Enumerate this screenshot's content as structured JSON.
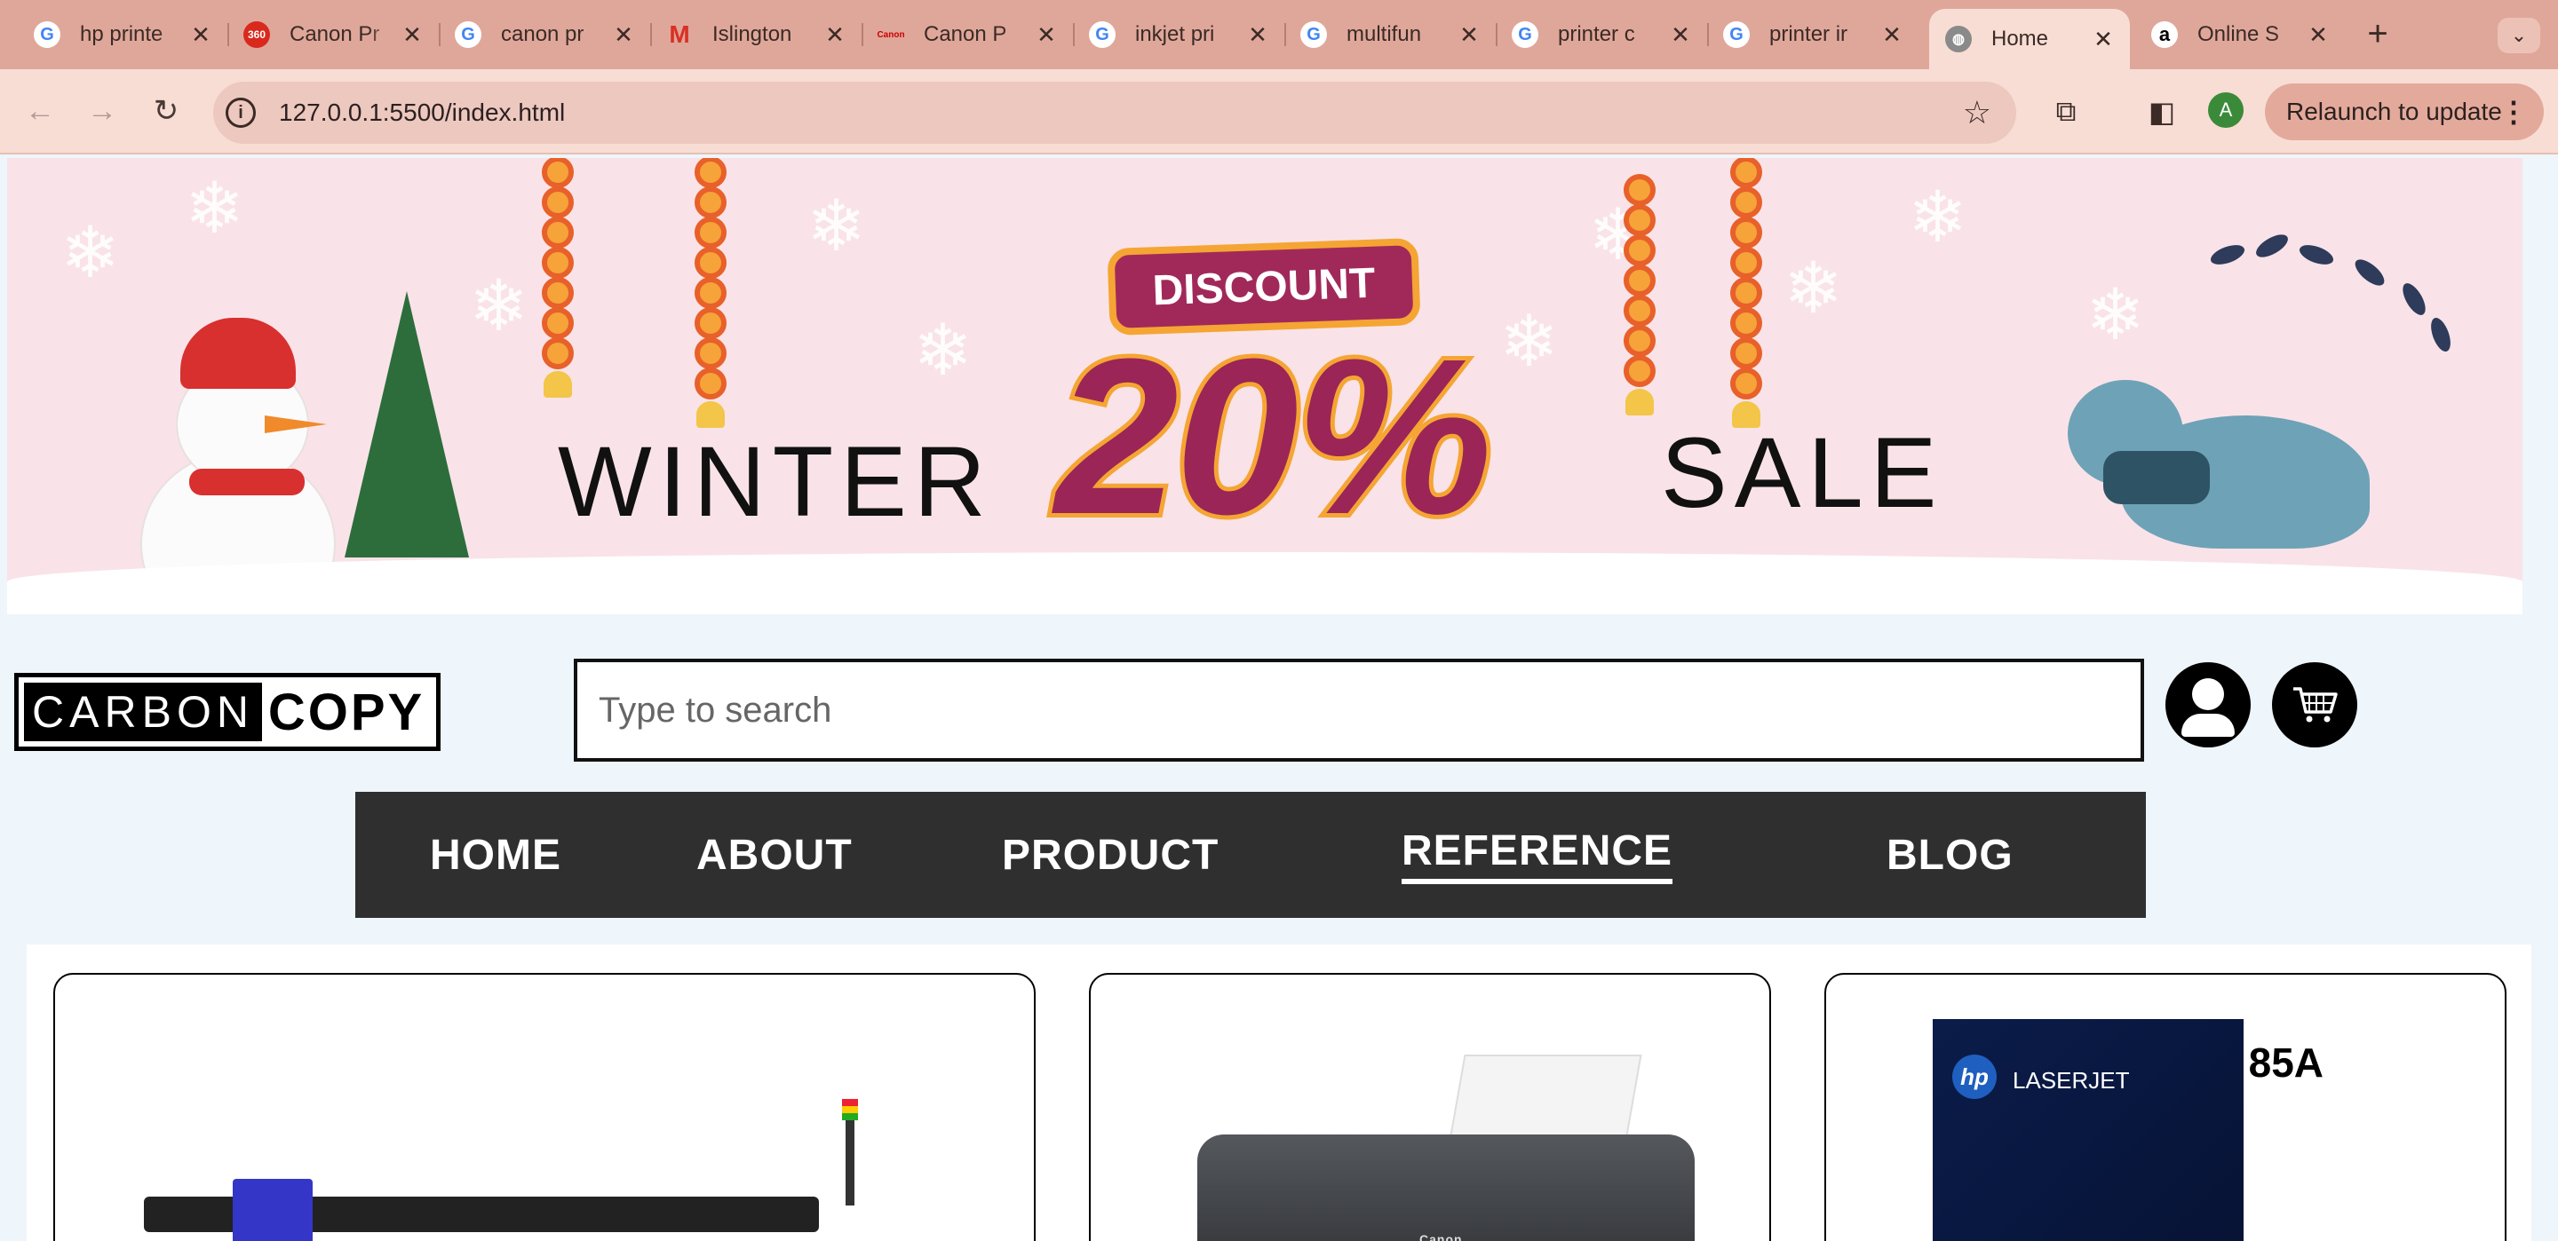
{
  "browser": {
    "tabs": [
      {
        "title": "hp printe",
        "favicon": "google-icon"
      },
      {
        "title": "Canon Pr",
        "favicon": "canon-360-icon"
      },
      {
        "title": "canon pr",
        "favicon": "google-icon"
      },
      {
        "title": "Islington",
        "favicon": "gmail-icon"
      },
      {
        "title": "Canon P",
        "favicon": "canon-icon"
      },
      {
        "title": "inkjet pri",
        "favicon": "google-icon"
      },
      {
        "title": "multifun",
        "favicon": "google-icon"
      },
      {
        "title": "printer c",
        "favicon": "google-icon"
      },
      {
        "title": "printer ir",
        "favicon": "google-icon"
      },
      {
        "title": "Home",
        "favicon": "globe-icon",
        "active": true
      },
      {
        "title": "Online S",
        "favicon": "amazon-icon"
      }
    ],
    "url": "127.0.0.1:5500/index.html",
    "profile_initial": "A",
    "relaunch_label": "Relaunch to update"
  },
  "banner": {
    "left_word": "WINTER",
    "badge": "DISCOUNT",
    "percent": "20%",
    "right_word": "SALE"
  },
  "header": {
    "logo_left": "CARBON",
    "logo_right": "COPY",
    "search_placeholder": "Type to search"
  },
  "nav": {
    "items": [
      "HOME",
      "ABOUT",
      "PRODUCT",
      "REFERENCE",
      "BLOG"
    ],
    "active": "REFERENCE"
  },
  "products": {
    "card2_brand": "Canon",
    "card3_brand_logo": "hp",
    "card3_line": "LASERJET",
    "card3_model": "85A"
  },
  "colors": {
    "nav_bg": "#2f2f2f",
    "tabstrip": "#dfa79a",
    "banner_bg": "#f9e3e8",
    "discount": "#9a2556"
  }
}
